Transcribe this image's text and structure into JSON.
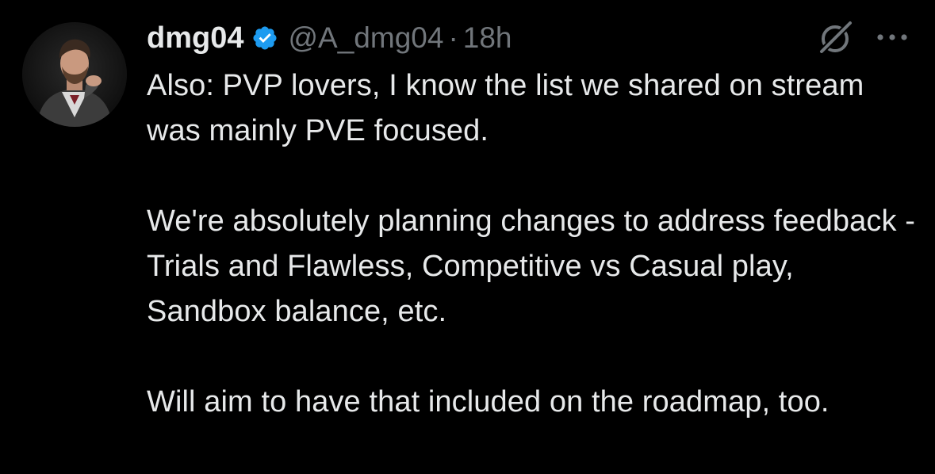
{
  "tweet": {
    "display_name": "dmg04",
    "handle": "@A_dmg04",
    "separator": "·",
    "time": "18h",
    "verified": true,
    "paragraphs": [
      "Also: PVP lovers, I know the list we shared on stream was mainly PVE focused.",
      "We're absolutely planning changes to address feedback - Trials and Flawless, Competitive vs Casual play, Sandbox balance, etc.",
      "Will aim to have that included on the roadmap, too."
    ]
  },
  "icons": {
    "avatar": "avatar",
    "verified": "verified-badge-icon",
    "grok": "grok-icon",
    "more": "more-options-icon"
  },
  "colors": {
    "background": "#000000",
    "text": "#e7e9ea",
    "muted": "#71767b",
    "verified": "#1d9bf0"
  }
}
